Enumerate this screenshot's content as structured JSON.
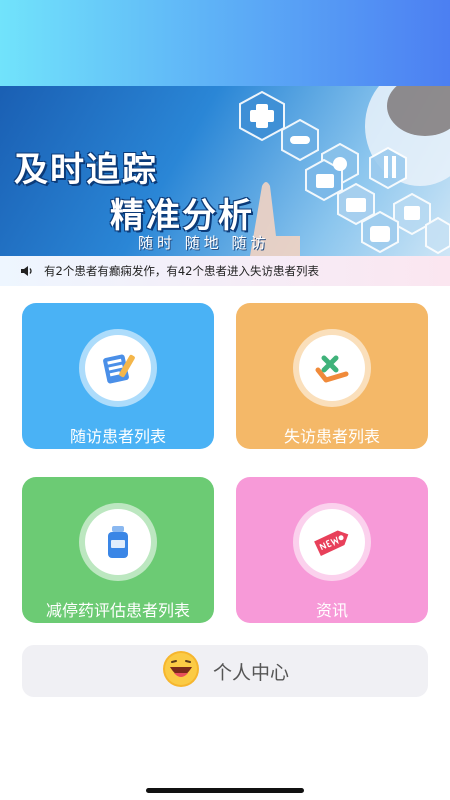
{
  "banner": {
    "headline_1": "及时追踪",
    "headline_2": "精准分析",
    "tagline": "随时 随地 随访"
  },
  "notice": {
    "icon": "speaker-icon",
    "text": "有2个患者有癫痫发作，有42个患者进入失访患者列表"
  },
  "cards": [
    {
      "label": "随访患者列表",
      "icon": "clipboard-icon",
      "color": "#4ab2f5"
    },
    {
      "label": "失访患者列表",
      "icon": "cross-check-icon",
      "color": "#f4b868"
    },
    {
      "label": "减停药评估患者列表",
      "icon": "medicine-bottle-icon",
      "color": "#6ccb74"
    },
    {
      "label": "资讯",
      "icon": "new-tag-icon",
      "color": "#f79ad8"
    }
  ],
  "personal_center": {
    "label": "个人中心",
    "icon": "smiley-icon"
  }
}
